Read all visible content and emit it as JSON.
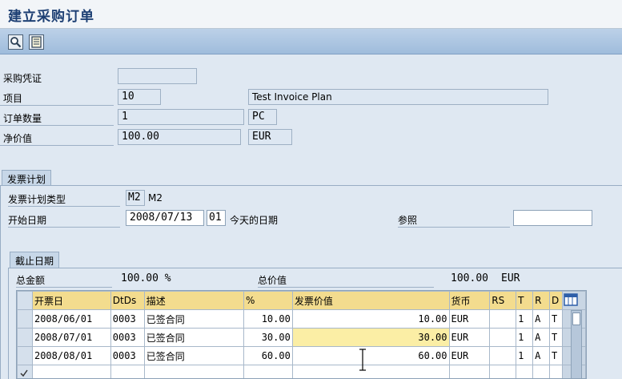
{
  "window": {
    "title": "建立采购订单"
  },
  "toolbar": {
    "buttons": [
      {
        "icon": "magnifier-icon"
      },
      {
        "icon": "document-list-icon"
      }
    ]
  },
  "header": {
    "purchase_doc": {
      "label": "采购凭证",
      "value": ""
    },
    "item": {
      "label": "项目",
      "value": "10",
      "text": "Test Invoice Plan"
    },
    "quantity": {
      "label": "订单数量",
      "value": "1",
      "unit": "PC"
    },
    "net_value": {
      "label": "净价值",
      "value": "100.00",
      "currency": "EUR"
    }
  },
  "invoice_plan": {
    "tab_label": "发票计划",
    "type": {
      "label": "发票计划类型",
      "code": "M2",
      "text": "M2"
    },
    "start_date": {
      "label": "开始日期",
      "value": "2008/07/13",
      "code": "01",
      "text": "今天的日期"
    },
    "reference": {
      "label": "参照",
      "value": ""
    }
  },
  "deadlines": {
    "tab_label": "截止日期",
    "total_amount": {
      "label": "总金额",
      "value": "100.00 %"
    },
    "total_value": {
      "label": "总价值",
      "value": "100.00",
      "currency": "EUR"
    },
    "columns": [
      "开票日",
      "DtDs",
      "描述",
      "%",
      "发票价值",
      "货币",
      "RS",
      "T",
      "R",
      "D"
    ],
    "rows": [
      {
        "date": "2008/06/01",
        "dtds": "0003",
        "desc": "已签合同",
        "pct": "10.00",
        "value": "10.00",
        "currency": "EUR",
        "rs": "",
        "t": "1",
        "r": "A",
        "d": "T"
      },
      {
        "date": "2008/07/01",
        "dtds": "0003",
        "desc": "已签合同",
        "pct": "30.00",
        "value": "30.00",
        "currency": "EUR",
        "rs": "",
        "t": "1",
        "r": "A",
        "d": "T"
      },
      {
        "date": "2008/08/01",
        "dtds": "0003",
        "desc": "已签合同",
        "pct": "60.00",
        "value": "60.00",
        "currency": "EUR",
        "rs": "",
        "t": "1",
        "r": "A",
        "d": "T"
      }
    ]
  }
}
